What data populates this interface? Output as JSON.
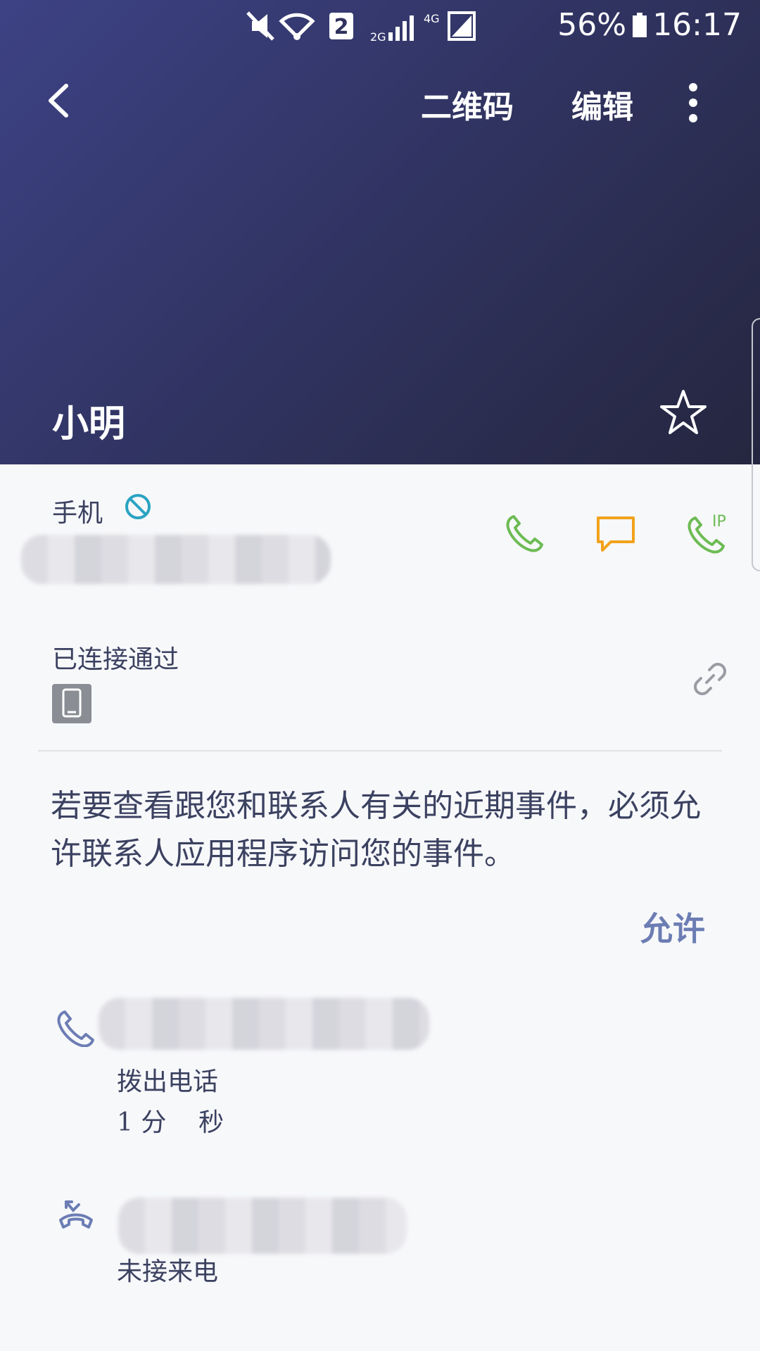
{
  "status_bar": {
    "battery_pct": "56%",
    "time": "16:17",
    "sim_badge": "2",
    "net_2g": "2G",
    "net_4g": "4G"
  },
  "toolbar": {
    "qr_label": "二维码",
    "edit_label": "编辑"
  },
  "contact": {
    "name": "小明"
  },
  "phone_section": {
    "label": "手机"
  },
  "connected_section": {
    "label": "已连接通过"
  },
  "notice": {
    "text": "若要查看跟您和联系人有关的近期事件，必须允许联系人应用程序访问您的事件。",
    "allow_label": "允许"
  },
  "call_log": [
    {
      "type_label": "拨出电话",
      "duration_label": "1 分    秒"
    },
    {
      "type_label": "未接来电"
    }
  ],
  "icons": {
    "back": "back-arrow-icon",
    "more": "more-vert-icon",
    "star": "star-outline-icon",
    "call": "phone-icon",
    "message": "message-icon",
    "ip_call": "ip-call-icon",
    "device": "tablet-icon",
    "link": "link-icon"
  },
  "colors": {
    "header_start": "#3d4285",
    "header_end": "#25263f",
    "call_green": "#6dbb54",
    "message_orange": "#f1a21c",
    "accent_blue": "#6c7db4"
  }
}
